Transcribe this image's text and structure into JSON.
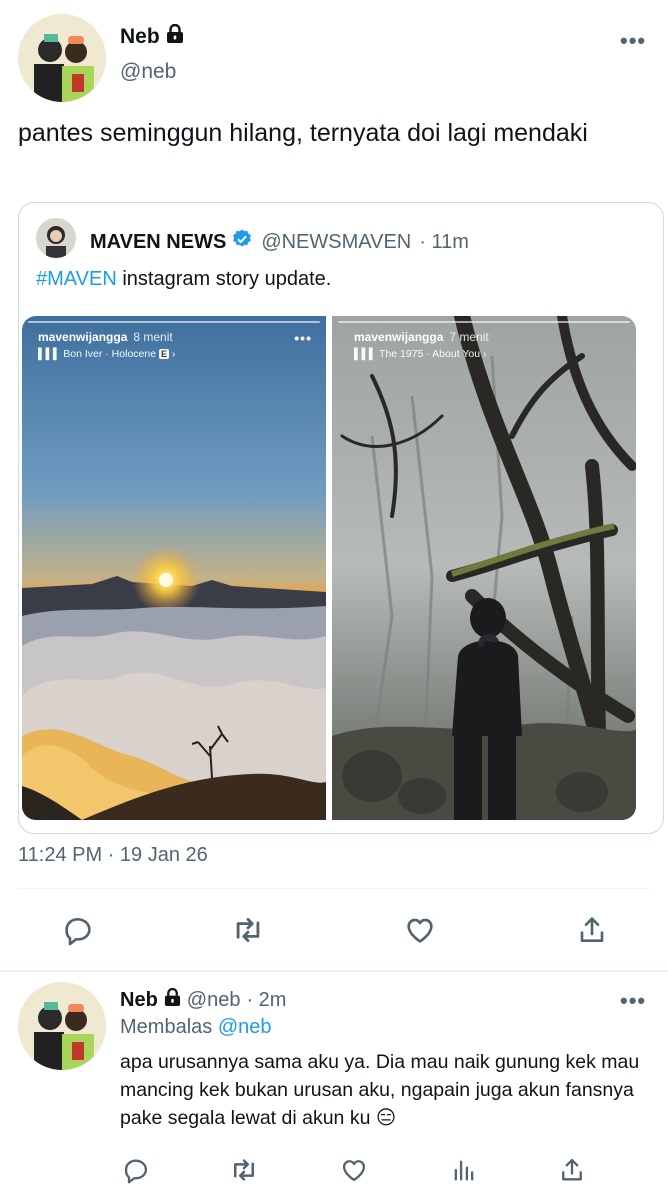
{
  "main_tweet": {
    "name": "Neb",
    "handle": "@neb",
    "text": "pantes seminggun hilang, ternyata doi lagi mendaki",
    "timestamp": "11:24 PM · 19 Jan 26"
  },
  "quote": {
    "name": "MAVEN NEWS",
    "handle": "@NEWSMAVEN",
    "time": "· 11m",
    "hashtag": "#MAVEN",
    "text_rest": " instagram story update.",
    "story_left": {
      "user": "mavenwijangga",
      "time": "8 menit",
      "music": "Bon Iver · Holocene",
      "explicit": "E"
    },
    "story_right": {
      "user": "mavenwijangga",
      "time": "7 menit",
      "music": "The 1975 · About You"
    }
  },
  "reply": {
    "name": "Neb",
    "handle": "@neb",
    "time": "· 2m",
    "replying_label": "Membalas",
    "replying_to": "@neb",
    "text": "apa urusannya sama aku ya. Dia mau naik gunung kek mau mancing kek bukan urusan aku, ngapain juga akun fansnya pake segala lewat di akun ku 😑"
  },
  "icons": {
    "reply": "reply-icon",
    "retweet": "retweet-icon",
    "like": "like-icon",
    "share": "share-icon",
    "analytics": "analytics-icon",
    "lock": "lock-icon",
    "verified": "verified-badge-icon"
  },
  "colors": {
    "accent": "#1d9bf0",
    "secondary_text": "#536471"
  }
}
